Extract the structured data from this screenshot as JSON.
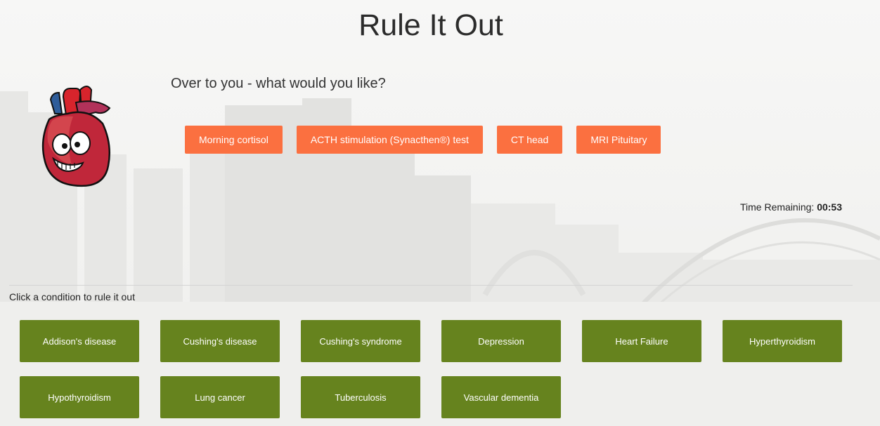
{
  "title": "Rule It Out",
  "prompt": "Over to you - what would you like?",
  "choices": [
    {
      "label": "Morning cortisol"
    },
    {
      "label": "ACTH stimulation (Synacthen®) test"
    },
    {
      "label": "CT head"
    },
    {
      "label": "MRI Pituitary"
    }
  ],
  "timer": {
    "label": "Time Remaining:",
    "value": "00:53"
  },
  "instruction": "Click a condition to rule it out",
  "conditions": [
    {
      "label": "Addison's disease"
    },
    {
      "label": "Cushing's disease"
    },
    {
      "label": "Cushing's syndrome"
    },
    {
      "label": "Depression"
    },
    {
      "label": "Heart Failure"
    },
    {
      "label": "Hyperthyroidism"
    },
    {
      "label": "Hypothyroidism"
    },
    {
      "label": "Lung cancer"
    },
    {
      "label": "Tuberculosis"
    },
    {
      "label": "Vascular dementia"
    }
  ],
  "colors": {
    "choice_button": "#fb7040",
    "condition_button": "#66831e",
    "background": "#f4f4f3"
  },
  "icons": {
    "mascot": "heart-mascot-icon"
  }
}
